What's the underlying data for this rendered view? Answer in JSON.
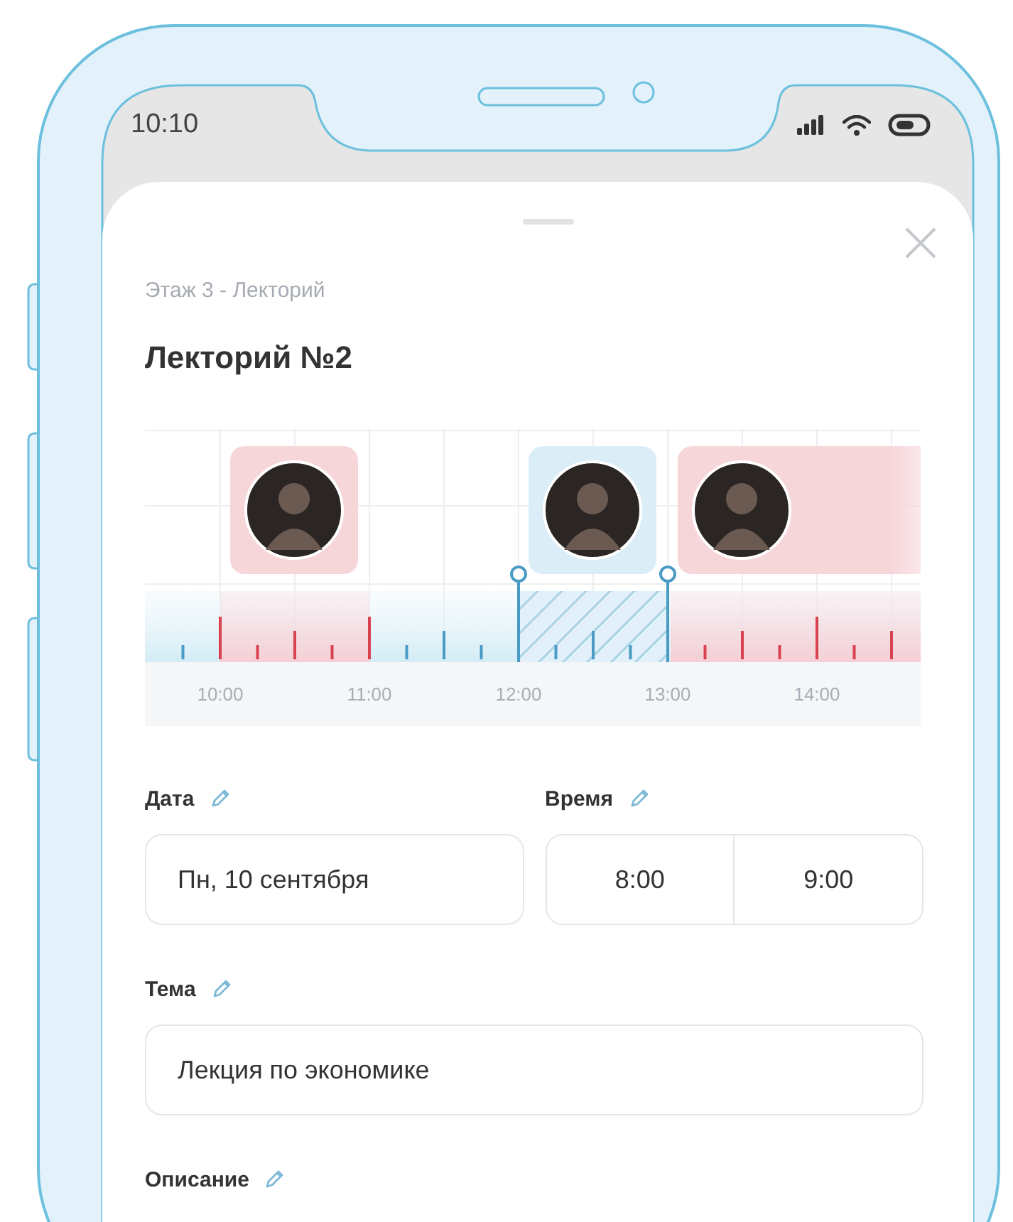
{
  "status_bar": {
    "time": "10:10"
  },
  "sheet": {
    "breadcrumb": "Этаж 3 - Лекторий",
    "title": "Лекторий №2"
  },
  "timeline": {
    "hours": [
      "10:00",
      "11:00",
      "12:00",
      "13:00",
      "14:00"
    ],
    "bookings": [
      {
        "selected": false
      },
      {
        "selected": true
      },
      {
        "selected": false
      }
    ]
  },
  "form": {
    "date": {
      "label": "Дата",
      "value": "Пн, 10 сентября"
    },
    "time": {
      "label": "Время",
      "start": "8:00",
      "end": "9:00"
    },
    "topic": {
      "label": "Тема",
      "value": "Лекция по экономике"
    },
    "description": {
      "label": "Описание"
    }
  }
}
